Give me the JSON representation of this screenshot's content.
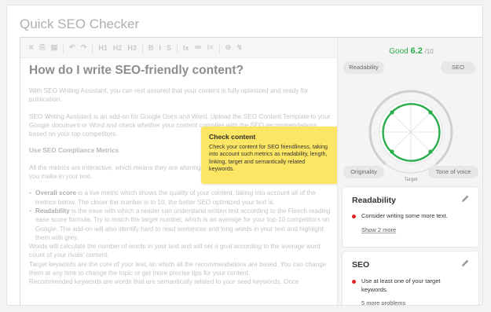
{
  "app": {
    "title": "Quick SEO Checker"
  },
  "toolbar": {
    "items": [
      "✕",
      "⎘",
      "▤",
      "↶",
      "↷",
      "H1",
      "H2",
      "H3",
      "B",
      "I",
      "S",
      "Ix",
      "≔",
      "⁝≡",
      "⊖",
      "↯"
    ]
  },
  "editor": {
    "heading": "How do I write SEO-friendly content?",
    "p1": "With SEO Writing Assistant, you can rest assured that your content is fully optimized and ready for publication.",
    "p2": "SEO Writing Assistant is an add-on for Google Docs and Word. Upload the SEO Content Template to your Google document or Word and check whether your content complies with the SEO recommendations based on your top competitors.",
    "h3": "Use SEO Compliance Metrics",
    "p3": "All the metrics are interactive, which means they are altering on a live basis depending on the changes you make in your text.",
    "li1_bold": "Overall score",
    "li1_text": " is a live metric which shows the quality of your content, taking into account all of the metrics below. The closer the number is to 10, the better SEO optimized your text is.",
    "li2_bold": "Readability",
    "li2_text": " is the ease with which a reader can understand written text according to the Flesch reading ease score formula. Try to match the target number, which is an average for your top-10 competitors on Google. The add-on will also identify hard to read sentences and long words in your text and highlight them with grey.",
    "p4": "Words will calculate the number of words in your text and will set a goal according to the average word count of your rivals' content.",
    "p5": "Target keywords are the core of your text, on which all the recommendations are based. You can change them at any time to change the topic or get more precise tips for your content.",
    "p6": "Recommended keywords are words that are semantically related to your seed keywords. Once"
  },
  "tooltip": {
    "title": "Check content",
    "text": "Check your content for SEO friendliness, taking into account such metrics as readability, length, linking, target and semantically related keywords."
  },
  "score": {
    "label": "Good",
    "value": "6.2",
    "max": "/10",
    "color": "#2bad4b"
  },
  "radar": {
    "pills": {
      "top_left": "Readability",
      "top_right": "SEO",
      "bottom_left": "Originality",
      "bottom_right": "Tone of voice"
    },
    "target_label": "Target",
    "color": "#2bad4b"
  },
  "readability_card": {
    "title": "Readability",
    "issue": "Consider writing some more text.",
    "more": "Show 2 more"
  },
  "seo_card": {
    "title": "SEO",
    "issue": "Use at least one of your target keywords.",
    "more": "5 more problems"
  },
  "colors": {
    "issue_bullet": "#e32323",
    "tooltip_bg": "#fde663",
    "accent_green": "#2bad4b"
  }
}
